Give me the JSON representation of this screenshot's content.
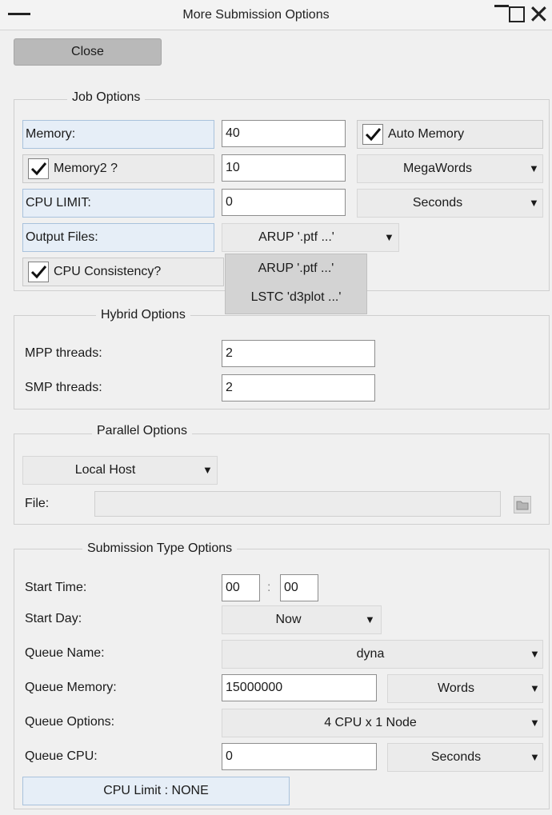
{
  "window": {
    "title": "More Submission Options",
    "close_glyph": "✕"
  },
  "toolbar": {
    "close_label": "Close"
  },
  "job_options": {
    "legend": "Job Options",
    "memory_label": "Memory:",
    "memory_value": "40",
    "auto_memory_label": "Auto Memory",
    "auto_memory_checked": true,
    "memory2_label": "Memory2 ?",
    "memory2_checked": true,
    "memory2_value": "10",
    "memory2_unit": "MegaWords",
    "cpu_limit_label": "CPU LIMIT:",
    "cpu_limit_value": "0",
    "cpu_limit_unit": "Seconds",
    "output_files_label": "Output Files:",
    "output_files_value": "ARUP '.ptf ...'",
    "output_files_options": [
      "ARUP '.ptf ...'",
      "LSTC 'd3plot ...'"
    ],
    "cpu_consistency_label": "CPU Consistency?",
    "cpu_consistency_checked": true
  },
  "hybrid_options": {
    "legend": "Hybrid Options",
    "mpp_label": "MPP threads:",
    "mpp_value": "2",
    "smp_label": "SMP threads:",
    "smp_value": "2"
  },
  "parallel_options": {
    "legend": "Parallel Options",
    "host_value": "Local Host",
    "file_label": "File:",
    "file_value": ""
  },
  "submission_type": {
    "legend": "Submission Type Options",
    "start_time_label": "Start Time:",
    "start_hour": "00",
    "time_sep": ":",
    "start_minute": "00",
    "start_day_label": "Start Day:",
    "start_day_value": "Now",
    "queue_name_label": "Queue Name:",
    "queue_name_value": "dyna",
    "queue_memory_label": "Queue Memory:",
    "queue_memory_value": "15000000",
    "queue_memory_unit": "Words",
    "queue_options_label": "Queue Options:",
    "queue_options_value": "4 CPU x 1 Node",
    "queue_cpu_label": "Queue CPU:",
    "queue_cpu_value": "0",
    "queue_cpu_unit": "Seconds",
    "cpu_limit_status": "CPU Limit : NONE"
  },
  "icons": {
    "check": "check-icon",
    "dropdown": "triangle-down-icon",
    "file_browse": "folder-icon"
  }
}
